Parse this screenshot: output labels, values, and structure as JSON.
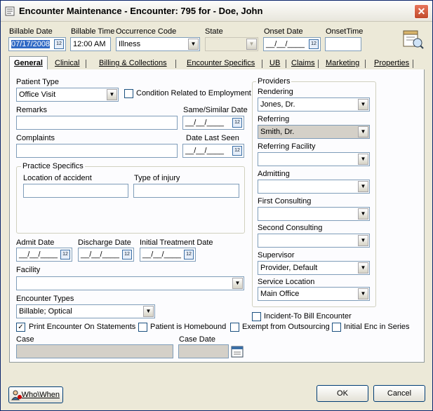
{
  "window": {
    "title": "Encounter Maintenance - Encounter: 795 for - Doe, John",
    "close_glyph": "✕"
  },
  "header": {
    "billable_date_label": "Billable Date",
    "billable_date_value": "07/17/2008",
    "billable_time_label": "Billable Time",
    "billable_time_value": "12:00 AM",
    "occurrence_code_label": "Occurrence Code",
    "occurrence_code_value": "Illness",
    "state_label": "State",
    "state_value": "",
    "onset_date_label": "Onset Date",
    "onset_date_value": "__/__/____",
    "onset_time_label": "OnsetTime",
    "onset_time_value": ""
  },
  "tabs": [
    {
      "label": "General"
    },
    {
      "label": "Clinical"
    },
    {
      "label": "Billing & Collections"
    },
    {
      "label": "Encounter Specifics"
    },
    {
      "label": "UB"
    },
    {
      "label": "Claims"
    },
    {
      "label": "Marketing"
    },
    {
      "label": "Properties"
    }
  ],
  "general": {
    "patient_type_label": "Patient Type",
    "patient_type_value": "Office Visit",
    "condition_related_label": "Condition Related to Employment",
    "remarks_label": "Remarks",
    "remarks_value": "",
    "same_similar_date_label": "Same/Similar Date",
    "same_similar_date_value": "__/__/____",
    "complaints_label": "Complaints",
    "complaints_value": "",
    "date_last_seen_label": "Date Last Seen",
    "date_last_seen_value": "__/__/____",
    "practice_specifics_title": "Practice Specifics",
    "location_of_accident_label": "Location of accident",
    "type_of_injury_label": "Type of injury",
    "admit_date_label": "Admit Date",
    "admit_date_value": "__/__/____",
    "discharge_date_label": "Discharge Date",
    "discharge_date_value": "__/__/____",
    "initial_treatment_date_label": "Initial Treatment Date",
    "initial_treatment_date_value": "__/__/____",
    "facility_label": "Facility",
    "facility_value": "",
    "encounter_types_label": "Encounter Types",
    "encounter_types_value": "Billable; Optical",
    "incident_to_label": "Incident-To Bill Encounter",
    "print_on_statements_label": "Print Encounter On Statements",
    "patient_homebound_label": "Patient is Homebound",
    "exempt_outsourcing_label": "Exempt from Outsourcing",
    "initial_enc_label": "Initial Enc in Series",
    "case_label": "Case",
    "case_value": "",
    "case_date_label": "Case Date",
    "case_date_value": ""
  },
  "providers": {
    "title": "Providers",
    "rendering_label": "Rendering",
    "rendering_value": "Jones, Dr.",
    "referring_label": "Referring",
    "referring_value": "Smith, Dr.",
    "referring_facility_label": "Referring Facility",
    "referring_facility_value": "",
    "admitting_label": "Admitting",
    "admitting_value": "",
    "first_consulting_label": "First Consulting",
    "first_consulting_value": "",
    "second_consulting_label": "Second Consulting",
    "second_consulting_value": "",
    "supervisor_label": "Supervisor",
    "supervisor_value": "Provider, Default",
    "service_location_label": "Service Location",
    "service_location_value": "Main Office"
  },
  "footer": {
    "who_when_label": "Who\\When",
    "ok_label": "OK",
    "cancel_label": "Cancel"
  },
  "glyphs": {
    "dropdown": "▼",
    "calendar": "12",
    "check": "✓"
  }
}
